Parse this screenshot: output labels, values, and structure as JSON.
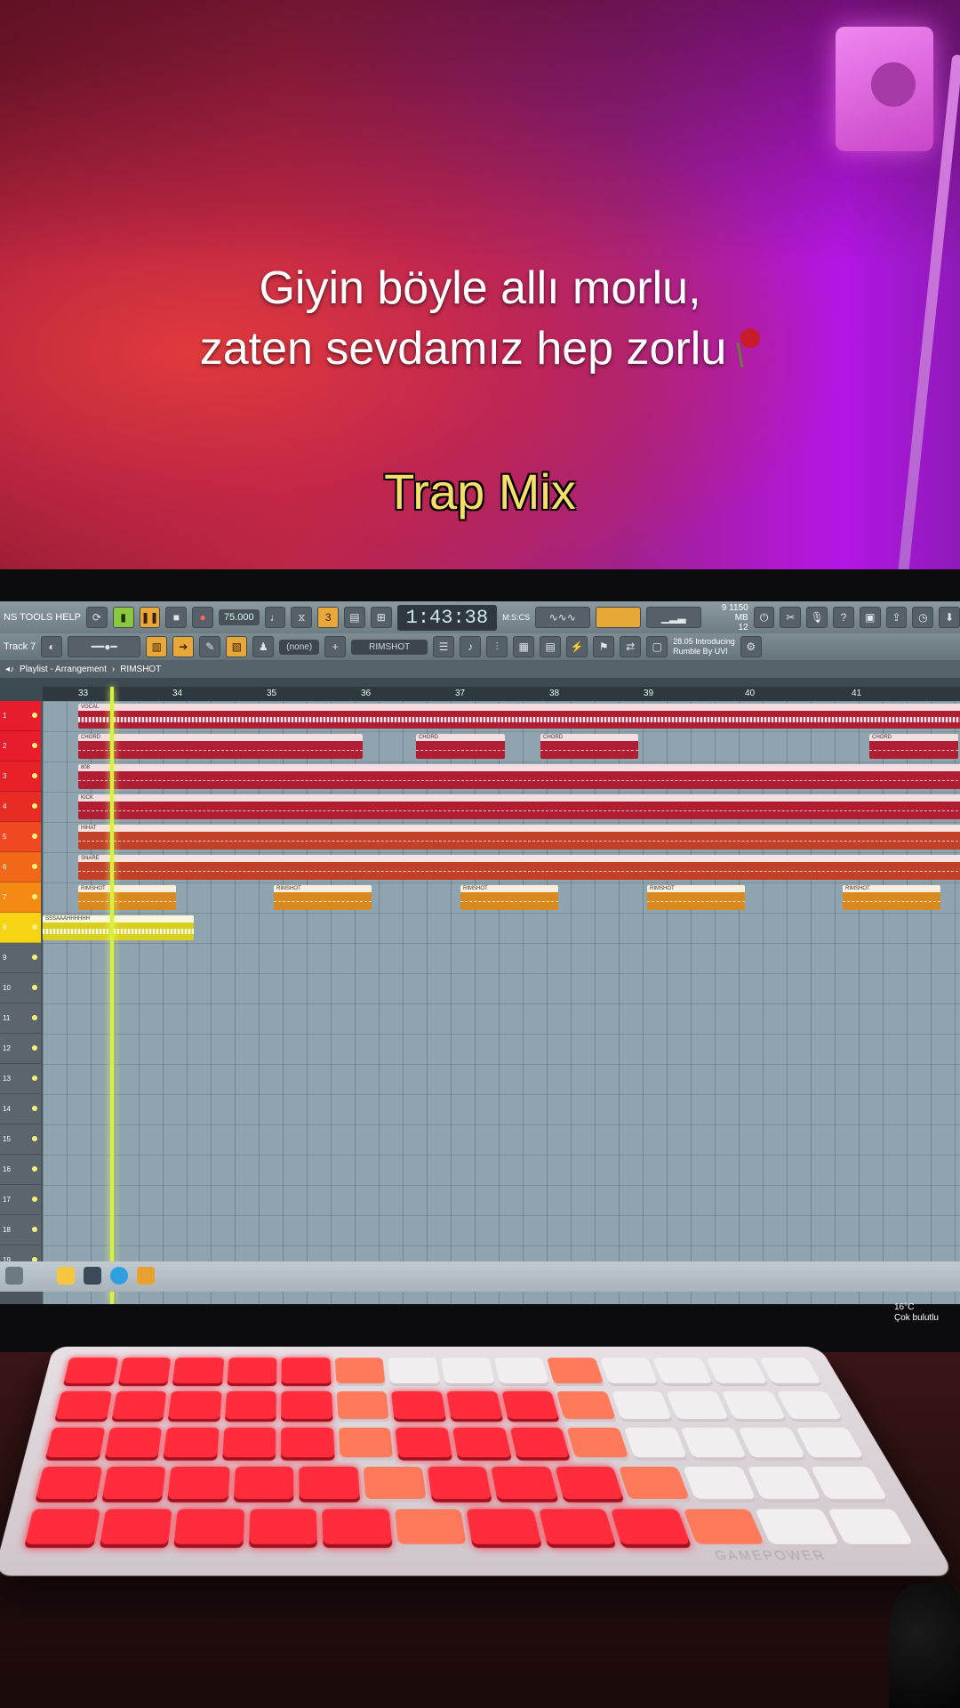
{
  "caption": {
    "line1": "Giyin böyle allı morlu,",
    "line2": "zaten sevdamız hep zorlu"
  },
  "overlay_title": "Trap Mix",
  "daw": {
    "menu": "NS TOOLS HELP",
    "tempo": "75.000",
    "time": "1:43:38",
    "time_label": "M:S:CS",
    "memory": {
      "voices": "9",
      "mb": "1150 MB",
      "cpu": "12"
    },
    "track_label": "Track 7",
    "pattern_none": "(none)",
    "pattern_name": "RIMSHOT",
    "hint": {
      "line1": "28.05  Introducing",
      "line2": "Rumble By UVI"
    },
    "breadcrumb": {
      "view": "Playlist - Arrangement",
      "separator": "›",
      "pattern": "RIMSHOT"
    },
    "ruler_marks": [
      "33",
      "34",
      "35",
      "36",
      "37",
      "38",
      "39",
      "40",
      "41"
    ],
    "tracks": [
      {
        "name": "VOCAL",
        "color": "#e81c2c"
      },
      {
        "name": "CHORD",
        "color": "#e81c2c"
      },
      {
        "name": "808",
        "color": "#e82028"
      },
      {
        "name": "KICK",
        "color": "#e82c24"
      },
      {
        "name": "HIHAT",
        "color": "#f04820"
      },
      {
        "name": "SNARE",
        "color": "#f06818"
      },
      {
        "name": "RIMSHOT",
        "color": "#f48a14"
      },
      {
        "name": "SSSAAAHHHHHH",
        "color": "#f6d414"
      }
    ],
    "track_numbers": [
      "1",
      "2",
      "3",
      "4",
      "5",
      "6",
      "7",
      "8",
      "9",
      "10",
      "11",
      "12",
      "13",
      "14",
      "15",
      "16",
      "17",
      "18",
      "19"
    ]
  },
  "taskbar": {
    "weather_temp": "16°C",
    "weather_desc": "Çok bulutlu"
  },
  "keyboard": {
    "brand": "GAMEPOWER"
  }
}
